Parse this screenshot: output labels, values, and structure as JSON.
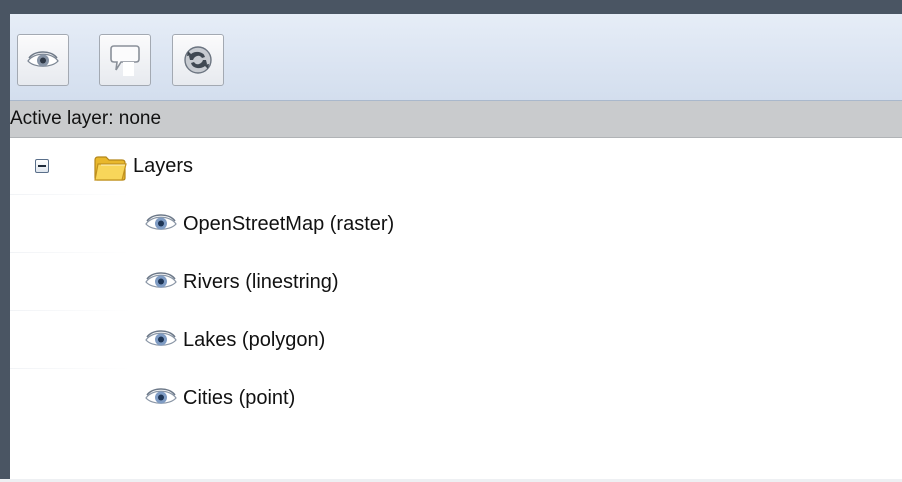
{
  "toolbar": {
    "buttons": [
      {
        "icon": "eye-icon"
      },
      {
        "icon": "speech-bubble-icon"
      },
      {
        "icon": "refresh-globe-icon"
      }
    ]
  },
  "active_layer": {
    "label": "Active layer: none"
  },
  "tree": {
    "root": {
      "label": "Layers",
      "expanded": true,
      "icon": "folder-icon"
    },
    "layers": [
      {
        "label": "OpenStreetMap (raster)",
        "visible": true,
        "icon": "eye-icon"
      },
      {
        "label": "Rivers (linestring)",
        "visible": true,
        "icon": "eye-icon"
      },
      {
        "label": "Lakes (polygon)",
        "visible": true,
        "icon": "eye-icon"
      },
      {
        "label": "Cities (point)",
        "visible": true,
        "icon": "eye-icon"
      }
    ]
  },
  "colors": {
    "frame": "#4a5563",
    "toolbar_top": "#e6edf7",
    "toolbar_bottom": "#d3deee",
    "active_bar": "#c9cbcd",
    "folder": "#f3c43a",
    "eye": "#3d6fa8"
  }
}
